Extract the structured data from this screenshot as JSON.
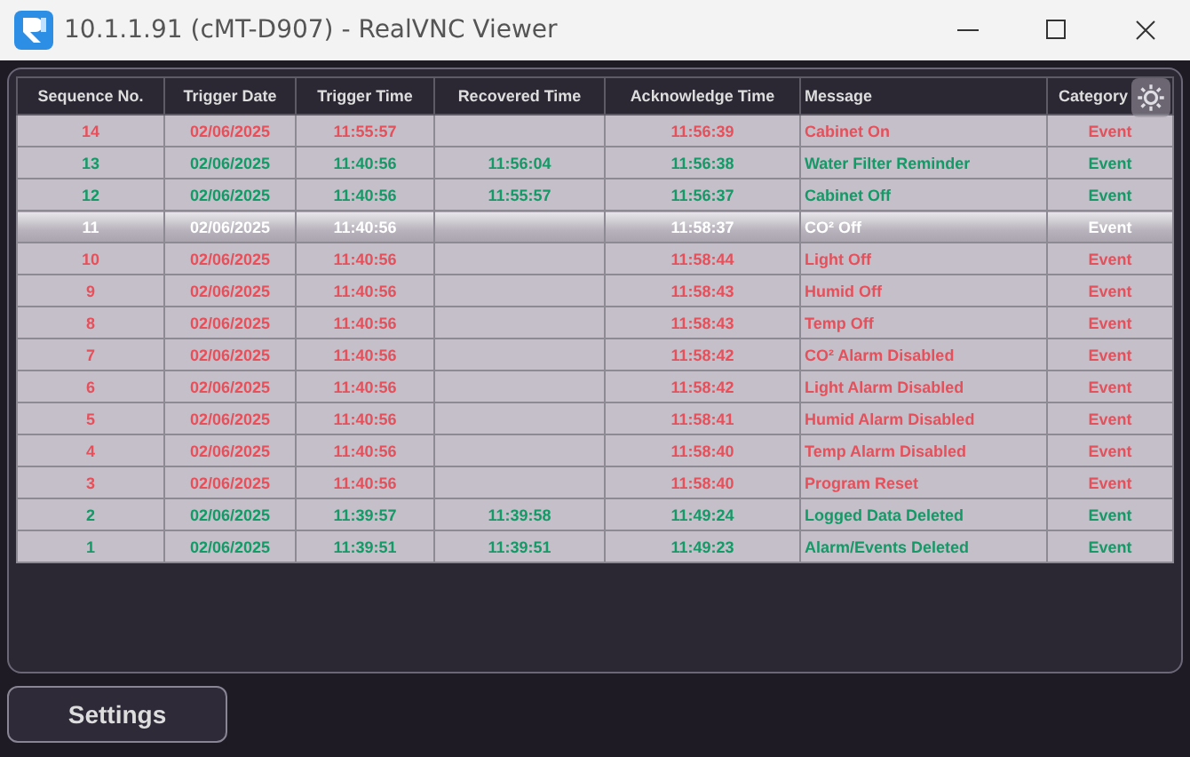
{
  "window": {
    "title": "10.1.1.91 (cMT-D907) - RealVNC Viewer"
  },
  "table": {
    "columns": [
      "Sequence No.",
      "Trigger Date",
      "Trigger Time",
      "Recovered Time",
      "Acknowledge Time",
      "Message",
      "Category"
    ],
    "rows": [
      {
        "cells": [
          "14",
          "02/06/2025",
          "11:55:57",
          "",
          "11:56:39",
          "Cabinet On",
          "Event"
        ],
        "color": "#e6505a",
        "selected": false
      },
      {
        "cells": [
          "13",
          "02/06/2025",
          "11:40:56",
          "11:56:04",
          "11:56:38",
          "Water Filter Reminder",
          "Event"
        ],
        "color": "#139a66",
        "selected": false
      },
      {
        "cells": [
          "12",
          "02/06/2025",
          "11:40:56",
          "11:55:57",
          "11:56:37",
          "Cabinet Off",
          "Event"
        ],
        "color": "#139a66",
        "selected": false
      },
      {
        "cells": [
          "11",
          "02/06/2025",
          "11:40:56",
          "",
          "11:58:37",
          "CO² Off",
          "Event"
        ],
        "selected": true
      },
      {
        "cells": [
          "10",
          "02/06/2025",
          "11:40:56",
          "",
          "11:58:44",
          "Light Off",
          "Event"
        ],
        "color": "#e6505a",
        "selected": false
      },
      {
        "cells": [
          "9",
          "02/06/2025",
          "11:40:56",
          "",
          "11:58:43",
          "Humid Off",
          "Event"
        ],
        "color": "#e6505a",
        "selected": false
      },
      {
        "cells": [
          "8",
          "02/06/2025",
          "11:40:56",
          "",
          "11:58:43",
          "Temp Off",
          "Event"
        ],
        "color": "#e6505a",
        "selected": false
      },
      {
        "cells": [
          "7",
          "02/06/2025",
          "11:40:56",
          "",
          "11:58:42",
          "CO² Alarm Disabled",
          "Event"
        ],
        "color": "#e6505a",
        "selected": false
      },
      {
        "cells": [
          "6",
          "02/06/2025",
          "11:40:56",
          "",
          "11:58:42",
          "Light Alarm Disabled",
          "Event"
        ],
        "color": "#e6505a",
        "selected": false
      },
      {
        "cells": [
          "5",
          "02/06/2025",
          "11:40:56",
          "",
          "11:58:41",
          "Humid Alarm Disabled",
          "Event"
        ],
        "color": "#e6505a",
        "selected": false
      },
      {
        "cells": [
          "4",
          "02/06/2025",
          "11:40:56",
          "",
          "11:58:40",
          "Temp Alarm Disabled",
          "Event"
        ],
        "color": "#e6505a",
        "selected": false
      },
      {
        "cells": [
          "3",
          "02/06/2025",
          "11:40:56",
          "",
          "11:58:40",
          "Program Reset",
          "Event"
        ],
        "color": "#e6505a",
        "selected": false
      },
      {
        "cells": [
          "2",
          "02/06/2025",
          "11:39:57",
          "11:39:58",
          "11:49:24",
          "Logged Data Deleted",
          "Event"
        ],
        "color": "#139a66",
        "selected": false
      },
      {
        "cells": [
          "1",
          "02/06/2025",
          "11:39:51",
          "11:39:51",
          "11:49:23",
          "Alarm/Events Deleted",
          "Event"
        ],
        "color": "#139a66",
        "selected": false
      }
    ]
  },
  "buttons": [
    "Settings"
  ]
}
